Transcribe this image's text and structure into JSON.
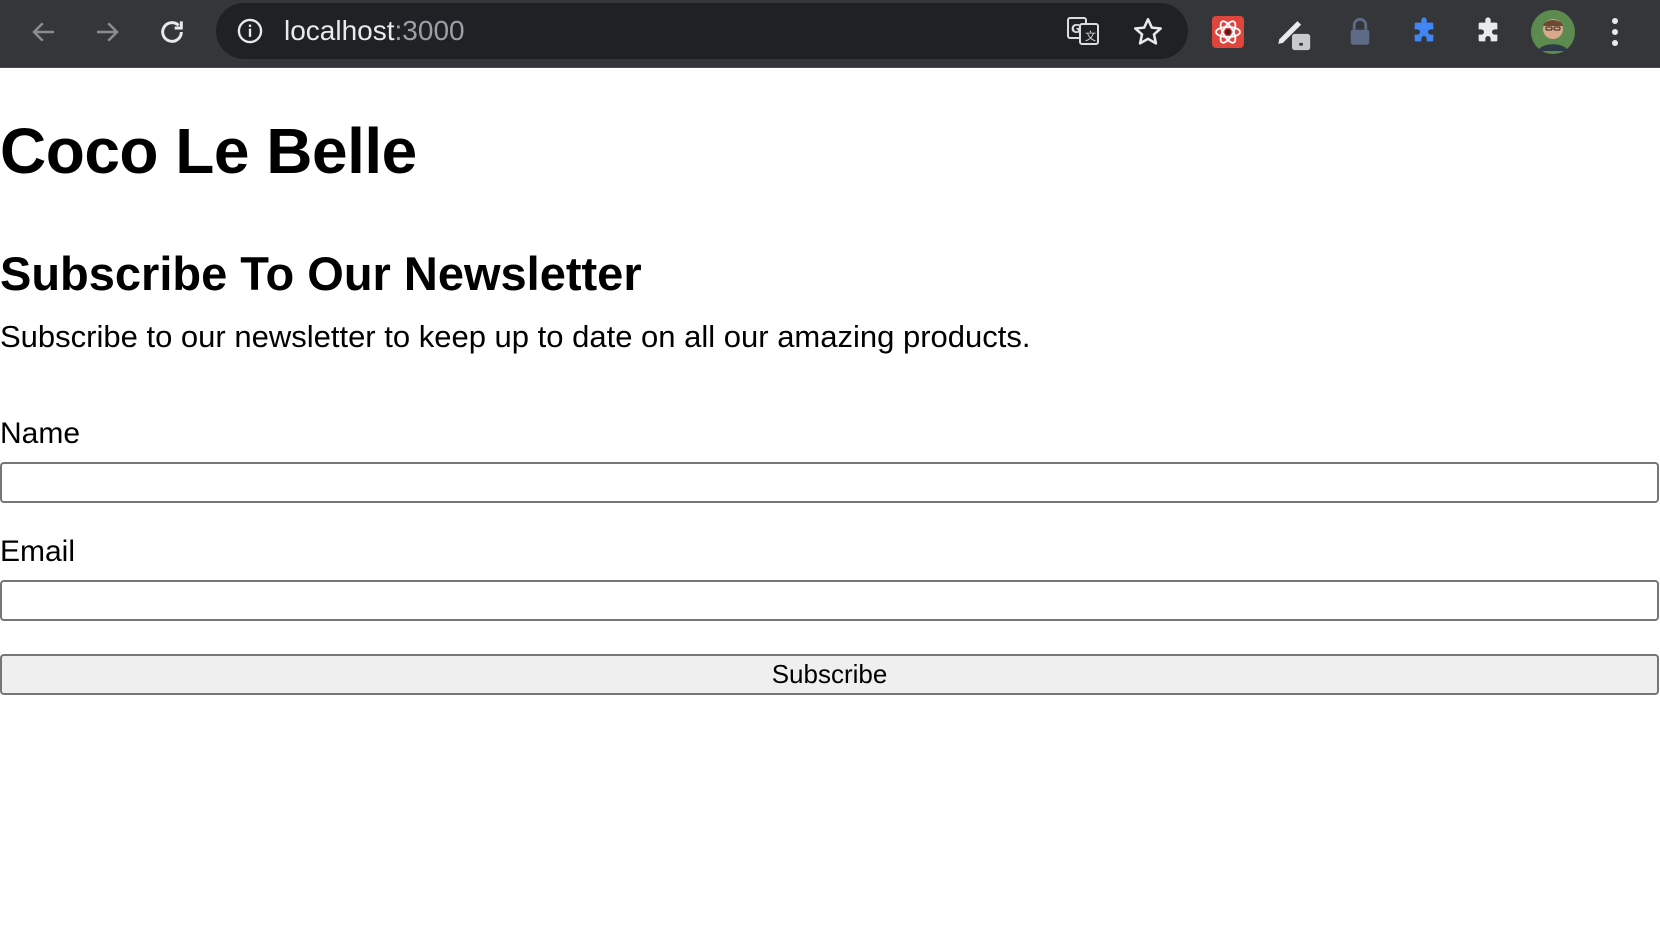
{
  "browser": {
    "url_host": "localhost",
    "url_port": ":3000",
    "icons": {
      "back": "arrow-left-icon",
      "forward": "arrow-right-icon",
      "reload": "reload-icon",
      "info": "info-icon",
      "translate": "translate-icon",
      "bookmark": "star-icon",
      "extensions": [
        "react-devtools-icon",
        "pen-icon",
        "lock-icon",
        "puzzle-blue-icon",
        "puzzle-icon",
        "avatar",
        "kebab-menu-icon"
      ]
    }
  },
  "page": {
    "title": "Coco Le Belle",
    "newsletter_heading": "Subscribe To Our Newsletter",
    "newsletter_text": "Subscribe to our newsletter to keep up to date on all our amazing products.",
    "form": {
      "name_label": "Name",
      "name_value": "",
      "email_label": "Email",
      "email_value": "",
      "submit_label": "Subscribe"
    }
  }
}
